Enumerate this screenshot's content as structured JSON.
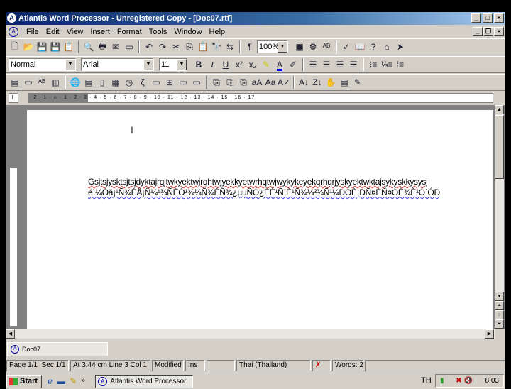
{
  "window": {
    "title": "Atlantis Word Processor - Unregistered Copy - [Doc07.rtf]",
    "app_icon": "A"
  },
  "menu": [
    "File",
    "Edit",
    "View",
    "Insert",
    "Format",
    "Tools",
    "Window",
    "Help"
  ],
  "toolbar1": [
    "new-doc",
    "open",
    "save",
    "save-as",
    "templates",
    "print-preview",
    "print",
    "email",
    "send",
    "undo",
    "redo",
    "cut",
    "copy",
    "paste",
    "find",
    "replace",
    "paragraph-marks",
    "zoom",
    "full-screen",
    "options",
    "spell",
    "spell-check",
    "thesaurus",
    "help",
    "home",
    "bookmark"
  ],
  "toolbar1_zoom": "100%",
  "toolbar2": {
    "style": "Normal",
    "font": "Arial",
    "size": "11",
    "buttons": [
      "bold",
      "italic",
      "underline",
      "superscript",
      "subscript",
      "highlight",
      "font-color",
      "format-painter",
      "align-left",
      "center",
      "align-right",
      "justify",
      "bullets",
      "numbering",
      "outline"
    ]
  },
  "toolbar2_labels": {
    "bold": "B",
    "italic": "I",
    "underline": "U"
  },
  "toolbar3": [
    "autotext",
    "save-all",
    "superscript-ab",
    "columns",
    "web",
    "insert-field",
    "insert-page",
    "insert-date",
    "insert-time",
    "symbol",
    "insert-object",
    "insert-table",
    "cell-props",
    "table",
    "copy-format",
    "paste-format",
    "format-clear",
    "change-case-up",
    "change-case-down",
    "autocorrect",
    "sort-asc",
    "sort-desc",
    "grab",
    "page-setup",
    "pencil"
  ],
  "ruler": {
    "labels": "· 2 · 1 · ⌂ · 1 · 2 · 3 · 4 · 5 · 6 · 7 · 8 · 9 · 10 · 11 · 12 · 13 · 14 · 15 · 16 · 17",
    "tab_selector": "L"
  },
  "document": {
    "lines": [
      "Gsjtsjysktsjtsjdyktajrqjtwkyektwjrqhtwjyekkyetwrhqtwjwykykeyekqrhqrjyskyektwktajsykyskkysysj",
      "é´¼Óä¡¹Ñ¾ÉÅ¡Ñ¼¹¾ÑÈÓ¹¾¼Ñ¾ÉÑ¾¿µµÑÓ¿ÈÈ¹Ñ´È¹Ñ¾¼²¾Ñ¹¼ÐÓÈ¡ÐÑ¤ÈÑ¤ÓÈ¾È¹Ó´ÓÐ"
    ]
  },
  "doctab": "Doc07",
  "status": {
    "page": "Page 1/1",
    "sec": "Sec 1/1",
    "position": "At 3.44 cm  Line 3  Col 1",
    "modified": "Modified",
    "ins": "Ins",
    "empty": "",
    "language": "Thai (Thailand)",
    "words": "Words: 2"
  },
  "taskbar": {
    "start": "Start",
    "chevron": "»",
    "task": "Atlantis Word Processor",
    "lang": "TH",
    "clock": "8:03"
  }
}
